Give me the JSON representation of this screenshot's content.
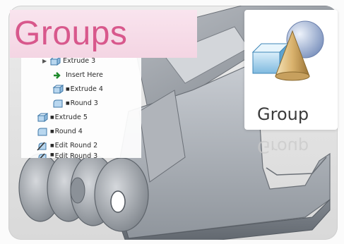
{
  "title": "Groups",
  "model_tree": {
    "items": [
      {
        "label": "Extrude 3",
        "icon": "extrude-icon",
        "expand": "▶",
        "marker": ""
      },
      {
        "label": "Insert Here",
        "icon": "insert-arrow-icon",
        "expand": "",
        "marker": ""
      },
      {
        "label": "Extrude 4",
        "icon": "extrude-icon",
        "expand": "",
        "marker": "■"
      },
      {
        "label": "Round 3",
        "icon": "round-icon",
        "expand": "",
        "marker": "■"
      },
      {
        "label": "Extrude 5",
        "icon": "extrude-icon",
        "expand": "",
        "marker": "■"
      },
      {
        "label": "Round 4",
        "icon": "round-icon",
        "expand": "",
        "marker": "■"
      },
      {
        "label": "Edit Round 2",
        "icon": "edit-round-icon",
        "expand": "",
        "marker": "■"
      },
      {
        "label": "Edit Round 3",
        "icon": "edit-round-icon",
        "expand": "",
        "marker": "■"
      }
    ]
  },
  "ribbon": {
    "group_label": "Group",
    "group_icon": "group-icon"
  },
  "colors": {
    "title_text": "#d8588c",
    "title_banner": "#f4d5e3",
    "insert_arrow": "#1e8a2c"
  }
}
